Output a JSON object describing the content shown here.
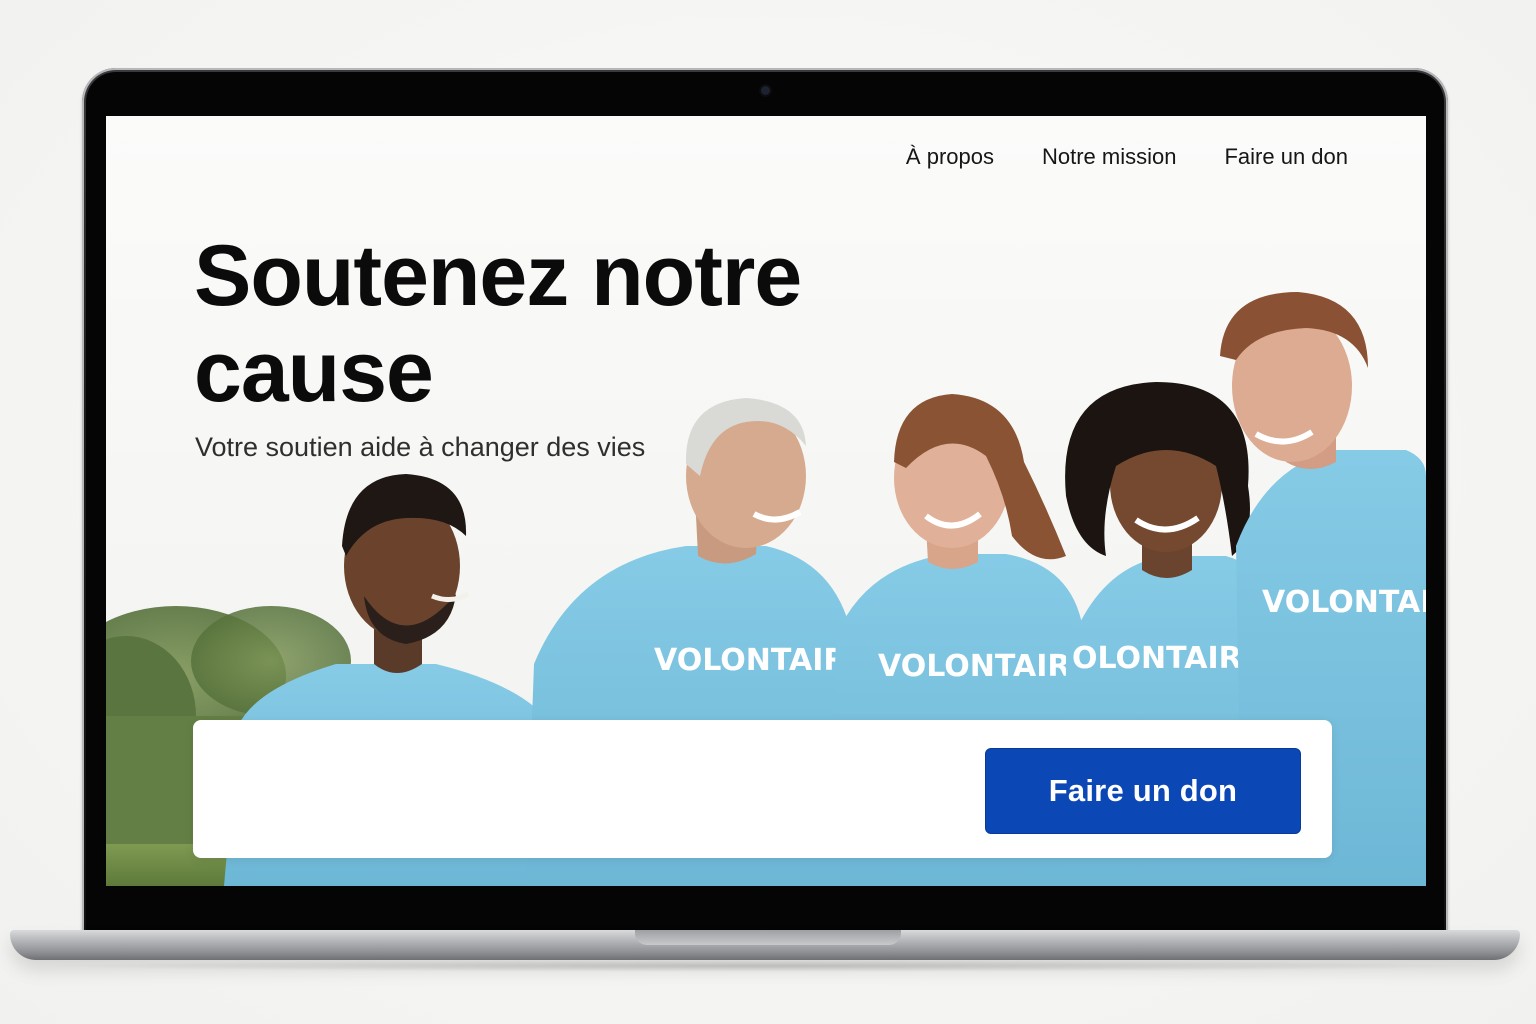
{
  "nav": {
    "items": [
      {
        "label": "À propos"
      },
      {
        "label": "Notre mission"
      },
      {
        "label": "Faire un don"
      }
    ]
  },
  "hero": {
    "title": "Soutenez notre cause",
    "subtitle": "Votre soutien aide à changer des vies",
    "shirt_text": "VOLONTAIRE",
    "shirt_text_cut": "OLONTAIRE"
  },
  "cta": {
    "button_label": "Faire un don"
  },
  "colors": {
    "accent": "#0b47b5",
    "shirt": "#7cc3df",
    "background": "#fafaf9"
  }
}
